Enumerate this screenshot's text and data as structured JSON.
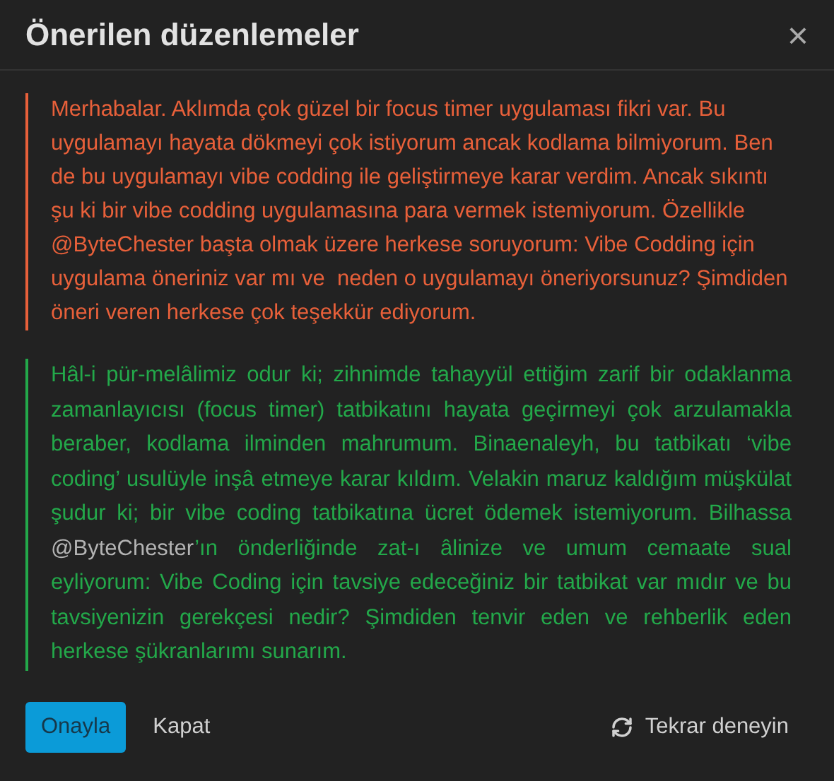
{
  "dialog": {
    "title": "Önerilen düzenlemeler",
    "close": "×"
  },
  "original": {
    "text": "Merhabalar. Aklımda çok güzel bir focus timer uygulaması fikri var. Bu uygulamayı hayata dökmeyi çok istiyorum ancak kodlama bilmiyorum. Ben de bu uygulamayı vibe codding ile geliştirmeye karar verdim. Ancak sıkıntı şu ki bir vibe codding uygulamasına para vermek istemiyorum. Özellikle @ByteChester başta olmak üzere herkese soruyorum: Vibe Codding için uygulama öneriniz var mı ve  neden o uygulamayı öneriyorsunuz? Şimdiden öneri veren herkese çok teşekkür ediyorum."
  },
  "suggested": {
    "parts": [
      {
        "kind": "text",
        "text": "Hâl-i pür-melâlimiz odur ki; zihnimde tahayyül ettiğim zarif bir odaklanma zamanlayıcısı (focus timer) tatbikatını hayata geçirmeyi çok arzulamakla beraber, kodlama ilminden mahrumum. Binaenaleyh, bu tatbikatı ‘vibe coding’ usulüyle inşâ etmeye karar kıldım. Velakin maruz kaldığım müşkülat şudur ki; bir vibe coding tatbikatına ücret ödemek istemiyorum. Bilhassa "
      },
      {
        "kind": "mention",
        "text": "@ByteChester"
      },
      {
        "kind": "text",
        "text": "’ın önderliğinde zat-ı âlinize ve umum cemaate sual eyliyorum: Vibe Coding için tavsiye edeceğiniz bir tatbikat var mıdır ve bu tavsiyenizin gerekçesi nedir? Şimdiden tenvir eden ve rehberlik eden herkese şükranlarımı sunarım."
      }
    ]
  },
  "footer": {
    "confirm": "Onayla",
    "close": "Kapat",
    "retry": "Tekrar deneyin"
  }
}
